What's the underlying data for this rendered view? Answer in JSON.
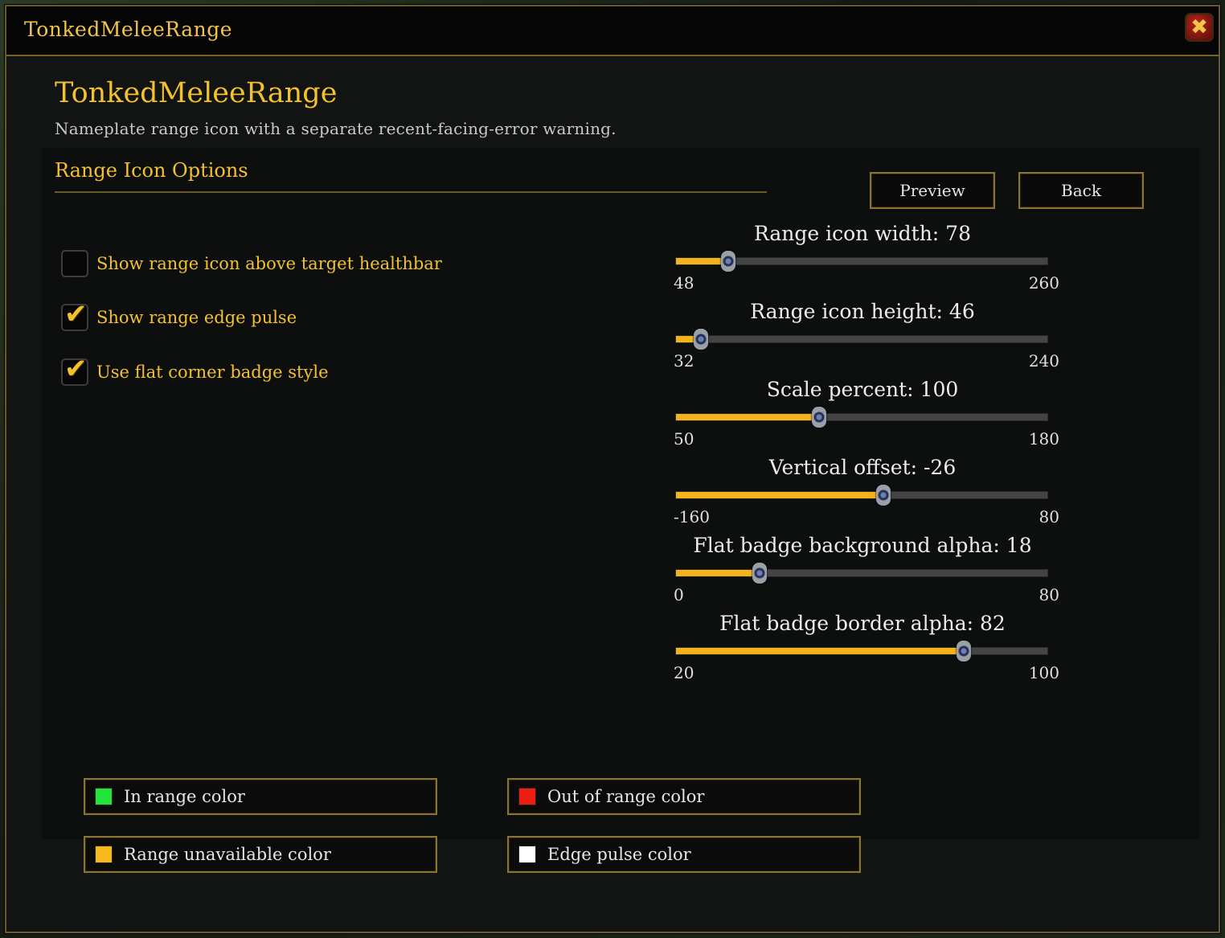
{
  "window": {
    "title": "TonkedMeleeRange",
    "close_glyph": "✖"
  },
  "header": {
    "title": "TonkedMeleeRange",
    "description": "Nameplate range icon with a separate recent-facing-error warning."
  },
  "section": {
    "title": "Range Icon Options"
  },
  "buttons": {
    "preview": "Preview",
    "back": "Back"
  },
  "checkboxes": [
    {
      "label": "Show range icon above target healthbar",
      "checked": false
    },
    {
      "label": "Show range edge pulse",
      "checked": true
    },
    {
      "label": "Use flat corner badge style",
      "checked": true
    }
  ],
  "checkmark_glyph": "✔",
  "sliders": [
    {
      "label": "Range icon width: 78",
      "min": 48,
      "max": 260,
      "value": 78,
      "min_label": "48",
      "max_label": "260"
    },
    {
      "label": "Range icon height: 46",
      "min": 32,
      "max": 240,
      "value": 46,
      "min_label": "32",
      "max_label": "240"
    },
    {
      "label": "Scale percent: 100",
      "min": 50,
      "max": 180,
      "value": 100,
      "min_label": "50",
      "max_label": "180"
    },
    {
      "label": "Vertical offset: -26",
      "min": -160,
      "max": 80,
      "value": -26,
      "min_label": "-160",
      "max_label": "80"
    },
    {
      "label": "Flat badge background alpha: 18",
      "min": 0,
      "max": 80,
      "value": 18,
      "min_label": "0",
      "max_label": "80"
    },
    {
      "label": "Flat badge border alpha: 82",
      "min": 20,
      "max": 100,
      "value": 82,
      "min_label": "20",
      "max_label": "100"
    }
  ],
  "color_buttons": [
    {
      "label": "In range color",
      "color": "#22e33a"
    },
    {
      "label": "Out of range color",
      "color": "#ee1c12"
    },
    {
      "label": "Range unavailable color",
      "color": "#f6b81a"
    },
    {
      "label": "Edge pulse color",
      "color": "#ffffff"
    }
  ],
  "colors": {
    "accent": "#f4c12e",
    "border": "#8a7433"
  }
}
